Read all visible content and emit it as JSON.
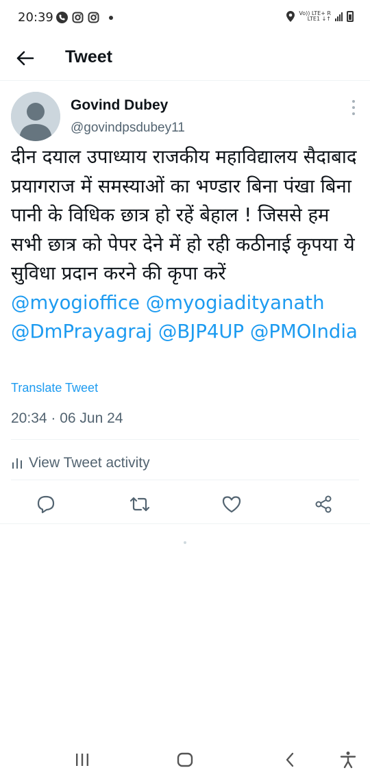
{
  "status_bar": {
    "time": "20:39",
    "network_line1": "Vo)) LTE+ R",
    "network_line2": "LTE1 ↓↑",
    "icons": [
      "phone-icon",
      "instagram-icon",
      "instagram-icon",
      "dot-icon",
      "location-icon",
      "signal-icon",
      "battery-icon"
    ]
  },
  "header": {
    "title": "Tweet",
    "back_icon": "arrow-left-icon"
  },
  "tweet": {
    "author": {
      "display_name": "Govind Dubey",
      "handle": "@govindpsdubey11"
    },
    "text_plain": "दीन दयाल उपाध्याय राजकीय महाविद्यालय सैदाबाद प्रयागराज में समस्याओं का भण्डार बिना पंखा बिना पानी के विधिक छात्र हो रहें बेहाल ! जिससे हम सभी छात्र को पेपर देने में हो रही कठीनाई कृपया ये सुविधा प्रदान करने की कृपा करें ",
    "mentions": [
      "@myogioffice",
      "@myogiadityanath",
      "@DmPrayagraj",
      "@BJP4UP",
      "@PMOIndia"
    ],
    "translate_label": "Translate Tweet",
    "timestamp": "20:34 · 06 Jun 24",
    "activity_label": "View Tweet activity"
  },
  "actions": [
    "reply-icon",
    "retweet-icon",
    "like-icon",
    "share-icon"
  ],
  "nav_bar": [
    "recent-apps-icon",
    "home-icon",
    "back-icon",
    "accessibility-icon"
  ],
  "colors": {
    "accent": "#1d9bf0",
    "text_primary": "#0f1419",
    "text_secondary": "#536471",
    "divider": "#eff3f4"
  }
}
